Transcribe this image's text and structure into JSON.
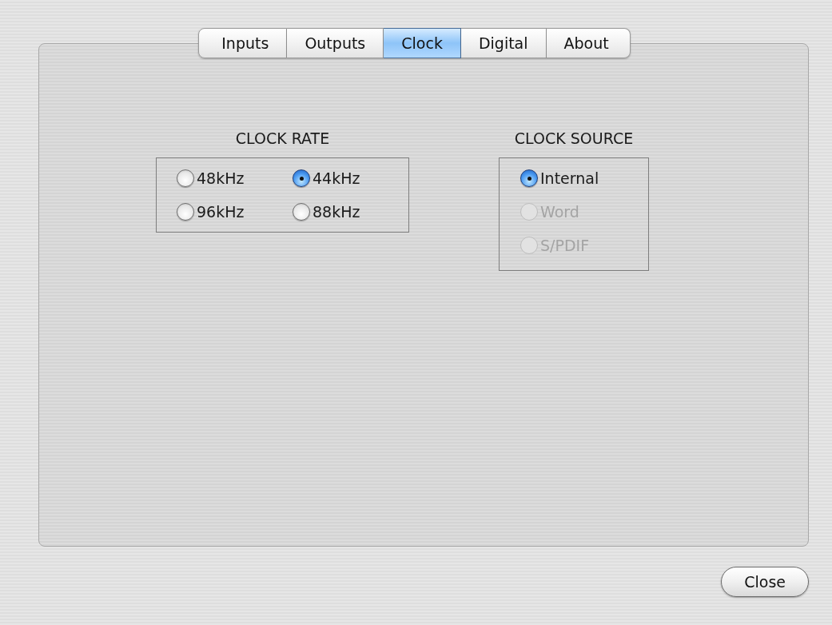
{
  "tabs": [
    {
      "label": "Inputs",
      "selected": false
    },
    {
      "label": "Outputs",
      "selected": false
    },
    {
      "label": "Clock",
      "selected": true
    },
    {
      "label": "Digital",
      "selected": false
    },
    {
      "label": "About",
      "selected": false
    }
  ],
  "clock_rate": {
    "title": "CLOCK RATE",
    "options": [
      {
        "label": "48kHz",
        "selected": false,
        "disabled": false
      },
      {
        "label": "44kHz",
        "selected": true,
        "disabled": false
      },
      {
        "label": "96kHz",
        "selected": false,
        "disabled": false
      },
      {
        "label": "88kHz",
        "selected": false,
        "disabled": false
      }
    ]
  },
  "clock_source": {
    "title": "CLOCK SOURCE",
    "options": [
      {
        "label": "Internal",
        "selected": true,
        "disabled": false
      },
      {
        "label": "Word",
        "selected": false,
        "disabled": true
      },
      {
        "label": "S/PDIF",
        "selected": false,
        "disabled": true
      }
    ]
  },
  "buttons": [
    "Close"
  ]
}
